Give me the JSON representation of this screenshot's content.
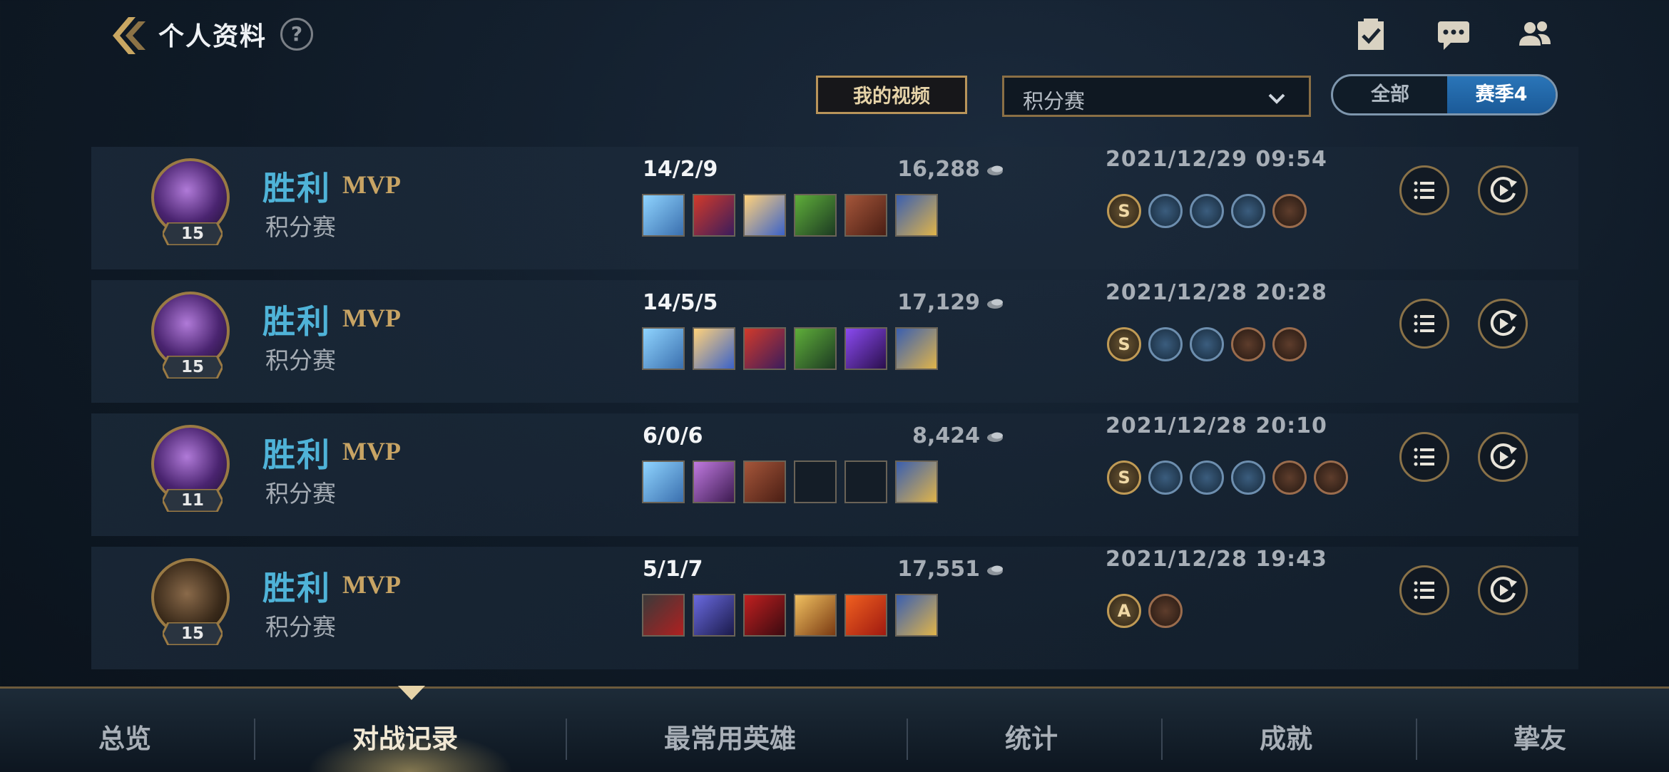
{
  "header": {
    "title": "个人资料",
    "help_label": "?",
    "icons": [
      "checklist-icon",
      "chat-icon",
      "friends-icon"
    ]
  },
  "toolbar": {
    "video_button": "我的视频",
    "mode_select_value": "积分赛",
    "season_options": [
      "全部",
      "赛季4"
    ],
    "season_selected": "赛季4"
  },
  "matches": [
    {
      "result": "胜利",
      "mvp": "MVP",
      "queue": "积分赛",
      "level": "15",
      "kda": "14/2/9",
      "gold": "16,288",
      "date": "2021/12/29 09:54",
      "champion": "purple-mage-champion-portrait",
      "items": [
        "item-rabadon",
        "item-wizard-hat",
        "item-orb",
        "item-dagger",
        "item-tome",
        "item-trinket"
      ],
      "runes": [
        "S",
        "rune-blue",
        "rune-blue",
        "rune-blue",
        "rune-bronze"
      ]
    },
    {
      "result": "胜利",
      "mvp": "MVP",
      "queue": "积分赛",
      "level": "15",
      "kda": "14/5/5",
      "gold": "17,129",
      "date": "2021/12/28 20:28",
      "champion": "purple-mage-champion-portrait",
      "items": [
        "item-rabadon",
        "item-orb",
        "item-wizard-hat",
        "item-dagger",
        "item-void-staff",
        "item-trinket"
      ],
      "runes": [
        "S",
        "rune-blue",
        "rune-blue",
        "rune-bronze",
        "rune-bronze"
      ]
    },
    {
      "result": "胜利",
      "mvp": "MVP",
      "queue": "积分赛",
      "level": "11",
      "kda": "6/0/6",
      "gold": "8,424",
      "date": "2021/12/28 20:10",
      "champion": "purple-mage-champion-portrait",
      "items": [
        "item-rabadon",
        "item-crystal-scepter",
        "item-tome",
        "empty",
        "empty",
        "item-trinket"
      ],
      "runes": [
        "S",
        "rune-blue",
        "rune-blue",
        "rune-blue",
        "rune-bronze",
        "rune-bronze"
      ]
    },
    {
      "result": "胜利",
      "mvp": "MVP",
      "queue": "积分赛",
      "level": "15",
      "kda": "5/1/7",
      "gold": "17,551",
      "date": "2021/12/28 19:43",
      "champion": "crocodile-champion-portrait",
      "items": [
        "item-black-cleaver",
        "item-spear",
        "item-claw",
        "item-sword",
        "item-potion",
        "item-trinket"
      ],
      "runes": [
        "A",
        "rune-bronze"
      ]
    }
  ],
  "tabs": [
    "总览",
    "对战记录",
    "最常用英雄",
    "统计",
    "成就",
    "挚友"
  ],
  "active_tab": "对战记录",
  "colors": {
    "accent_gold": "#c8a464",
    "win_blue": "#4fb3d8",
    "season_active": "#2a75b8"
  }
}
